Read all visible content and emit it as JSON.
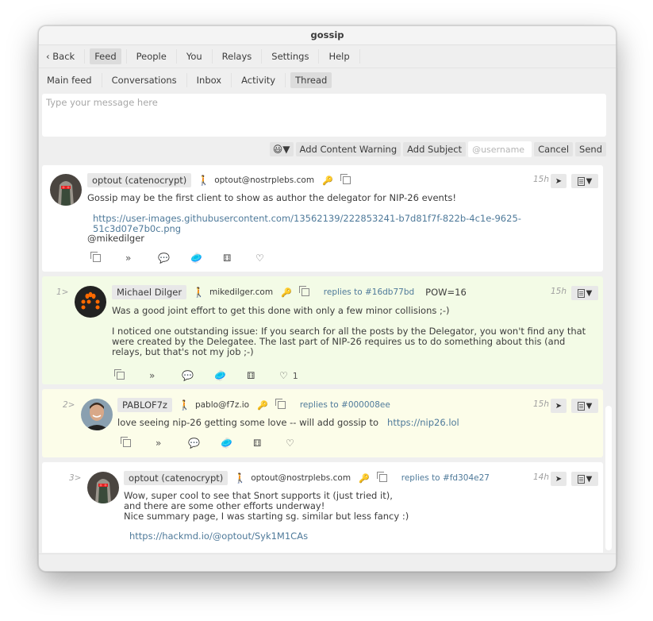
{
  "window": {
    "title": "gossip"
  },
  "top_menu": {
    "back": "‹ Back",
    "items": [
      "Feed",
      "People",
      "You",
      "Relays",
      "Settings",
      "Help"
    ],
    "selected": "Feed"
  },
  "sub_menu": {
    "items": [
      "Main feed",
      "Conversations",
      "Inbox",
      "Activity",
      "Thread"
    ],
    "selected": "Thread"
  },
  "composer": {
    "placeholder": "Type your message here",
    "value": "",
    "emoji_button": "😃▼",
    "content_warning": "Add Content Warning",
    "subject": "Add Subject",
    "username_placeholder": "@username",
    "cancel": "Cancel",
    "send": "Send"
  },
  "icons": {
    "walker": "🚶",
    "key": "🔑",
    "go": "➤",
    "menu_caret": "▼",
    "repost": "»",
    "reply": "💬",
    "zap": "🥏",
    "dice": "⚅",
    "heart": "♡"
  },
  "posts": [
    {
      "index": "",
      "name": "optout (catenocrypt)",
      "nip05": "optout@nostrplebs.com",
      "replies_to": "",
      "pow": "",
      "time": "15h",
      "has_go": true,
      "lines": [
        "Gossip may be the first client to show as author the delegator for NIP-26 events!"
      ],
      "link": "https://user-images.githubusercontent.com/13562139/222853241-b7d81f7f-822b-4c1e-9625-51c3d07e7b0c.png",
      "mention": "@mikedilger",
      "likes": ""
    },
    {
      "index": "1>",
      "name": "Michael Dilger",
      "nip05": "mikedilger.com",
      "replies_to": "replies to #16db77bd",
      "pow": "POW=16",
      "time": "15h",
      "has_go": false,
      "lines": [
        "Was a good joint effort to get this done with only a few minor collisions ;-)",
        "",
        "I noticed one outstanding issue: If you search for all the posts by the Delegator, you won't find any that were created by the Delegatee. The last part of NIP-26 requires us to do something about this (and relays, but that's not my job ;-)"
      ],
      "likes": "1"
    },
    {
      "index": "2>",
      "name": "PABLOF7z",
      "nip05": "pablo@f7z.io",
      "replies_to": "replies to #000008ee",
      "pow": "",
      "time": "15h",
      "has_go": true,
      "text": "love seeing nip-26 getting some love -- will add gossip to",
      "link": "https://nip26.lol",
      "likes": ""
    },
    {
      "index": "3>",
      "name": "optout (catenocrypt)",
      "nip05": "optout@nostrplebs.com",
      "replies_to": "replies to #fd304e27",
      "pow": "",
      "time": "14h",
      "has_go": true,
      "lines": [
        "Wow, super cool to see that Snort supports it (just tried it),",
        "and there are some other efforts underway!",
        "Nice summary page, I was starting sg. similar but less fancy :)"
      ],
      "link": "https://hackmd.io/@optout/Syk1M1CAs"
    }
  ],
  "colors": {
    "link": "#4f7a9a",
    "post_root": "#ffffff",
    "post_green": "#f3fbe6",
    "post_yellow": "#fcfde9"
  }
}
